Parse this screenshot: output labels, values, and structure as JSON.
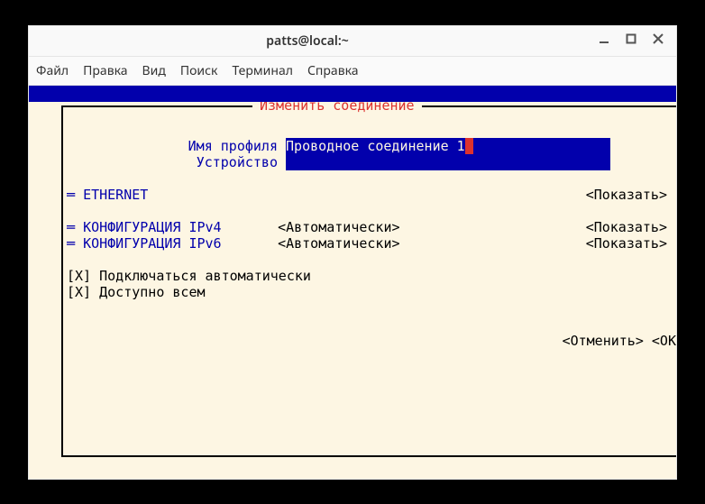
{
  "titlebar": {
    "title": "patts@local:~"
  },
  "menu": {
    "file": "Файл",
    "edit": "Правка",
    "view": "Вид",
    "search": "Поиск",
    "terminal": "Терминал",
    "help": "Справка"
  },
  "dialog": {
    "title": "Изменить соединение"
  },
  "profile": {
    "name_label": "Имя профиля",
    "name_value": "Проводное соединение 1",
    "device_label": "Устройство",
    "device_value": ""
  },
  "sections": {
    "ethernet": {
      "label": "ETHERNET",
      "action": "<Показать>"
    },
    "ipv4": {
      "label": "КОНФИГУРАЦИЯ IPv4",
      "value": "<Автоматически>",
      "action": "<Показать>"
    },
    "ipv6": {
      "label": "КОНФИГУРАЦИЯ IPv6",
      "value": "<Автоматически>",
      "action": "<Показать>"
    }
  },
  "checkboxes": {
    "auto_connect": "[X] Подключаться автоматически",
    "available_all": "[X] Доступно всем"
  },
  "buttons": {
    "cancel": "<Отменить>",
    "ok": "<OK"
  }
}
